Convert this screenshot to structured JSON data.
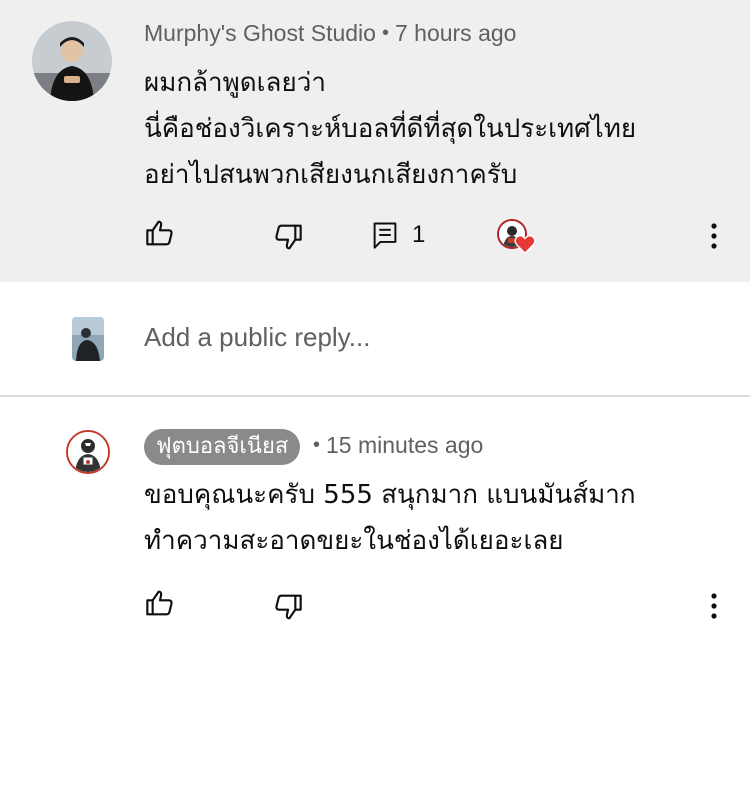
{
  "highlighted_comment": {
    "author": "Murphy's Ghost Studio",
    "separator": "•",
    "time": "7 hours ago",
    "lines": [
      "ผมกล้าพูดเลยว่า",
      "นี่คือช่องวิเคราะห์บอลที่ดีที่สุดในประเทศไทย",
      "อย่าไปสนพวกเสียงนกเสียงกาครับ"
    ],
    "reply_count": "1",
    "icons": {
      "like": "thumb-up-icon",
      "dislike": "thumb-down-icon",
      "reply": "comment-icon",
      "hearted": "creator-heart-icon",
      "more": "more-vert-icon"
    },
    "heart_color": "#e53935"
  },
  "reply_box": {
    "placeholder": "Add a public reply..."
  },
  "reply_comment": {
    "author": "ฟุตบอลจีเนียส",
    "separator": "•",
    "time": "15 minutes ago",
    "lines": [
      "ขอบคุณนะครับ 555 สนุกมาก แบนมันส์มาก",
      "ทำความสะอาดขยะในช่องได้เยอะเลย"
    ],
    "badge_color": "#8a8a8a"
  },
  "colors": {
    "highlight_bg": "#efefef",
    "secondary_text": "#606060"
  }
}
